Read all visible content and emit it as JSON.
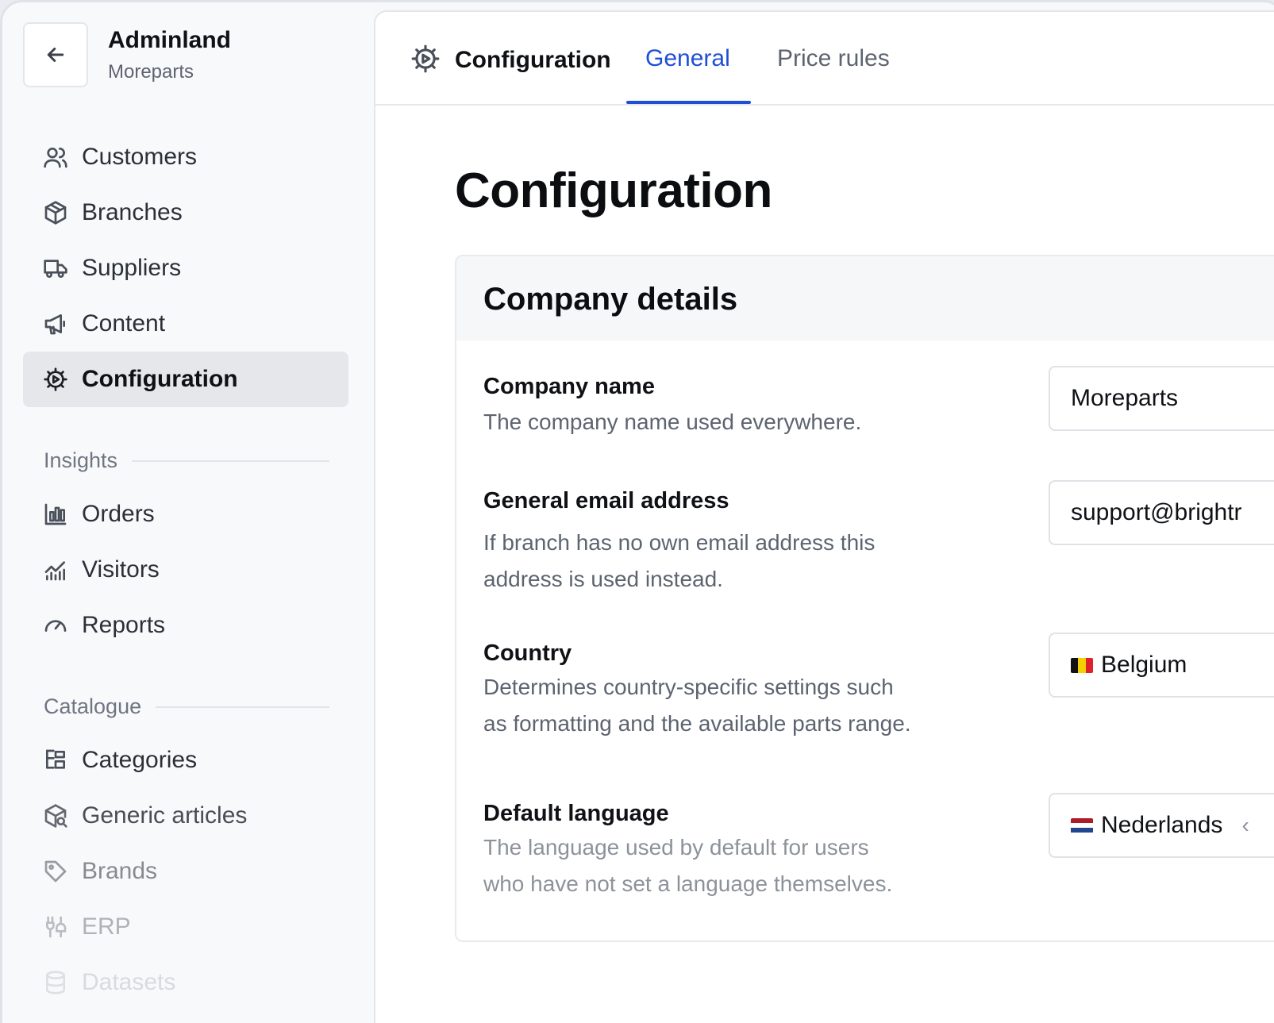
{
  "app": {
    "title": "Adminland",
    "subtitle": "Moreparts"
  },
  "sidebar": {
    "items": [
      {
        "label": "Customers",
        "icon": "users-icon"
      },
      {
        "label": "Branches",
        "icon": "box-icon"
      },
      {
        "label": "Suppliers",
        "icon": "truck-icon"
      },
      {
        "label": "Content",
        "icon": "megaphone-icon"
      },
      {
        "label": "Configuration",
        "icon": "gear-icon",
        "active": true
      }
    ],
    "insights": {
      "heading": "Insights",
      "items": [
        {
          "label": "Orders",
          "icon": "bar-chart-icon"
        },
        {
          "label": "Visitors",
          "icon": "trend-chart-icon"
        },
        {
          "label": "Reports",
          "icon": "gauge-icon"
        }
      ]
    },
    "catalogue": {
      "heading": "Catalogue",
      "items": [
        {
          "label": "Categories",
          "icon": "tree-icon"
        },
        {
          "label": "Generic articles",
          "icon": "box-search-icon"
        },
        {
          "label": "Brands",
          "icon": "tag-icon"
        },
        {
          "label": "ERP",
          "icon": "plug-icon"
        },
        {
          "label": "Datasets",
          "icon": "database-icon"
        }
      ]
    }
  },
  "header": {
    "section": "Configuration",
    "tabs": [
      {
        "label": "General",
        "active": true
      },
      {
        "label": "Price rules",
        "active": false
      }
    ]
  },
  "main": {
    "title": "Configuration",
    "card": {
      "title": "Company details",
      "fields": [
        {
          "label": "Company name",
          "help": "The company name used everywhere.",
          "value": "Moreparts"
        },
        {
          "label": "General email address",
          "help_line1": "If branch has no own email address this",
          "help_line2": "address is used instead.",
          "value": "support@brightr"
        },
        {
          "label": "Country",
          "help_line1": "Determines country-specific settings such",
          "help_line2": "as formatting and the available parts range.",
          "value": "Belgium"
        },
        {
          "label": "Default language",
          "help_line1": "The language used by default for users",
          "help_line2": "who have not set a language themselves.",
          "value": "Nederlands"
        }
      ]
    }
  },
  "colors": {
    "accent": "#1f4fd6",
    "active_nav_bg": "#e5e7ea"
  }
}
